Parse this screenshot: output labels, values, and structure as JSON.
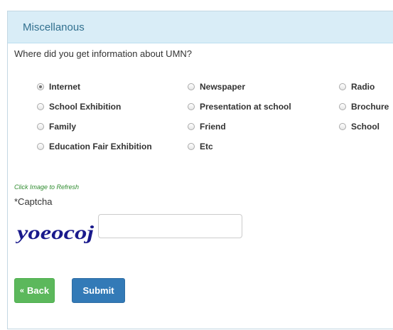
{
  "panel": {
    "title": "Miscellanous"
  },
  "question": "Where did you get information about UMN?",
  "options": [
    {
      "label": "Internet",
      "checked": true
    },
    {
      "label": "Newspaper",
      "checked": false
    },
    {
      "label": "Radio",
      "checked": false
    },
    {
      "label": "School Exhibition",
      "checked": false
    },
    {
      "label": "Presentation at school",
      "checked": false
    },
    {
      "label": "Brochure",
      "checked": false
    },
    {
      "label": "Family",
      "checked": false
    },
    {
      "label": "Friend",
      "checked": false
    },
    {
      "label": "School",
      "checked": false
    },
    {
      "label": "Education Fair Exhibition",
      "checked": false
    },
    {
      "label": "Etc",
      "checked": false
    }
  ],
  "captcha": {
    "hint": "Click Image to Refresh",
    "label": "*Captcha",
    "image_text": "yoeocoj",
    "input_value": "",
    "input_placeholder": ""
  },
  "buttons": {
    "back_arrow": "«",
    "back_label": "Back",
    "submit_label": "Submit"
  },
  "colors": {
    "header_bg": "#d9edf7",
    "header_text": "#31708f",
    "back_button": "#5cb85c",
    "submit_button": "#337ab7",
    "captcha_text": "#1a1a8c"
  }
}
